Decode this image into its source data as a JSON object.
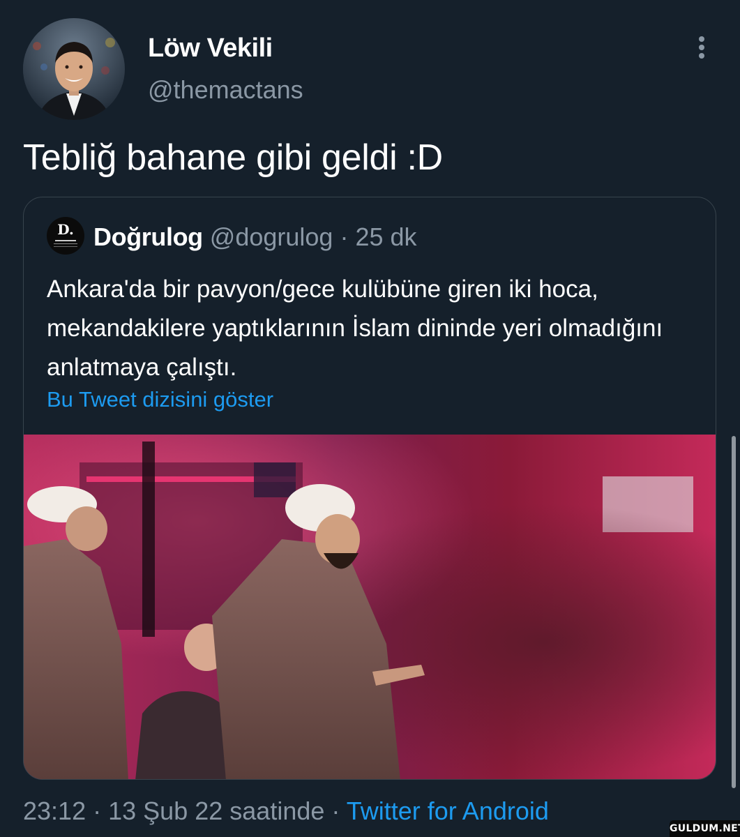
{
  "author": {
    "display_name": "Löw Vekili",
    "handle": "@themactans"
  },
  "tweet": {
    "text": "Tebliğ bahane gibi geldi :D"
  },
  "quoted_tweet": {
    "display_name": "Doğrulog",
    "handle": "@dogrulog",
    "separator": "·",
    "time": "25 dk",
    "avatar_letter": "D.",
    "text": "Ankara'da bir pavyon/gece kulübüne giren iki hoca, mekandakilere yaptıklarının İslam dininde yeri olmadığını anlatmaya çalıştı.",
    "thread_link": "Bu Tweet dizisini göster"
  },
  "footer": {
    "time": "23:12",
    "sep1": "·",
    "date": "13 Şub 22 saatinde",
    "sep2": "·",
    "source": "Twitter for Android"
  },
  "watermark": "GULDUM.NET",
  "colors": {
    "background": "#15202b",
    "secondary_text": "#8b98a5",
    "link": "#1d9bf0",
    "border": "#38444d"
  }
}
